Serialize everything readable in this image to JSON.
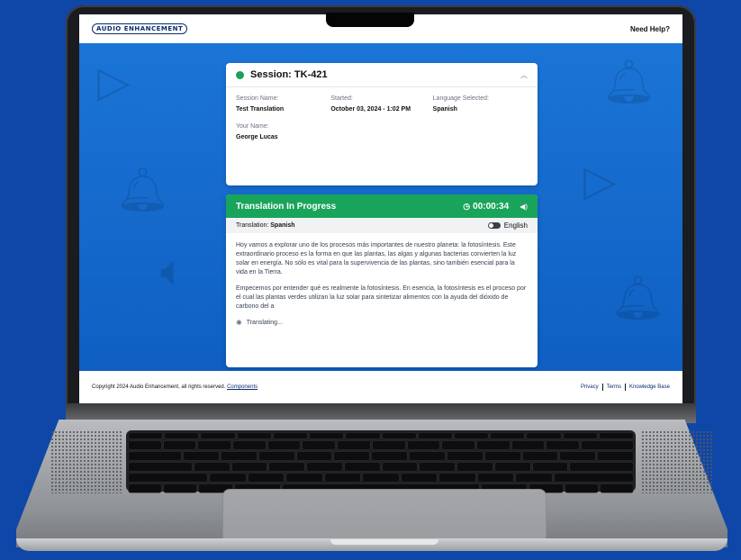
{
  "brand": {
    "logo_text": "AUDIO ENHANCEMENT"
  },
  "header": {
    "help_label": "Need Help?"
  },
  "session": {
    "title": "Session: TK-421",
    "name_label": "Session Name:",
    "name_value": "Test Translation",
    "started_label": "Started:",
    "started_value": "October 03, 2024 - 1:02 PM",
    "language_label": "Language Selected:",
    "language_value": "Spanish",
    "your_name_label": "Your Name:",
    "your_name_value": "George Lucas"
  },
  "translation": {
    "title": "Translation In Progress",
    "timer": "00:00:34",
    "lang_prefix": "Translation: ",
    "lang_value": "Spanish",
    "toggle_label": "English",
    "paragraph_1": "Hoy vamos a explorar uno de los procesos más importantes de nuestro planeta: la fotosíntesis. Este extraordinario proceso es la forma en que las plantas, las algas y algunas bacterias convierten la luz solar en energía. No sólo es vital para la supervivencia de las plantas, sino también esencial para la vida en la Tierra.",
    "paragraph_2": "Empecemos por entender qué es realmente la fotosíntesis. En esencia, la fotosíntesis es el proceso por el cual las plantas verdes utilizan la luz solar para sintetizar alimentos con la ayuda del dióxido de carbono del a",
    "status": "Translating..."
  },
  "footer": {
    "copyright": "Copyright 2024 Audio Enhancement, all rights reserved. ",
    "components_link": "Components",
    "privacy": "Privacy",
    "terms": "Terms",
    "knowledge_base": "Knowledge Base"
  },
  "colors": {
    "background": "#0f47a8",
    "accent_green": "#19a45c",
    "status_dot": "#1aa15a",
    "link_navy": "#0a2c6b",
    "main_blue": "#1b75d6"
  },
  "icons": [
    "bell-icon",
    "speaker-icon",
    "play-icon",
    "clock-icon",
    "volume-icon",
    "chevron-up-icon",
    "spinner-icon"
  ]
}
